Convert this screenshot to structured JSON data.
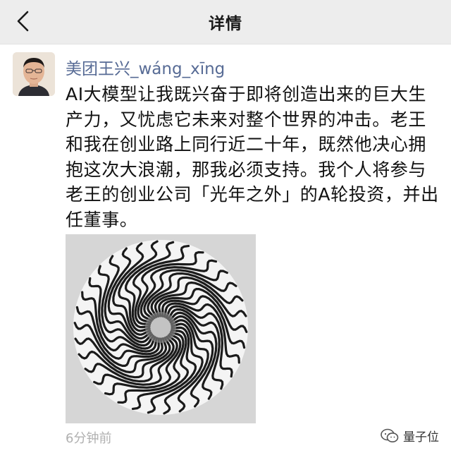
{
  "nav": {
    "title": "详情",
    "back_icon": "chevron-left-icon"
  },
  "post": {
    "author": "美团王兴_wáng_xīng",
    "text": "AI大模型让我既兴奋于即将创造出来的巨大生产力，又忧虑它未来对整个世界的冲击。老王和我在创业路上同行近二十年，既然他决心拥抱这次大浪潮，那我必须支持。我个人将参与老王的创业公司「光年之外」的A轮投资，并出任董事。",
    "timestamp": "6分钟前",
    "image": "spiral-optical-illusion-image"
  },
  "watermark": {
    "text": "量子位",
    "icon": "wechat-icon"
  },
  "colors": {
    "navbar_bg": "#ededed",
    "author_link": "#576b95",
    "timestamp": "#b0b0b0"
  }
}
